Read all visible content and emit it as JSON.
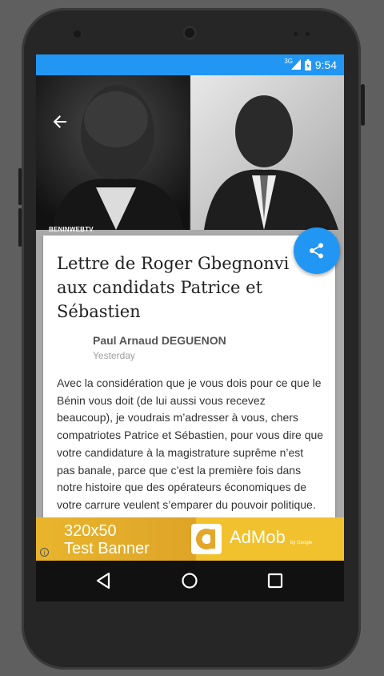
{
  "status_bar": {
    "network": "3G",
    "time": "9:54",
    "color": "#2196f3"
  },
  "hero": {
    "watermark": "BENINWEBTV"
  },
  "article": {
    "title": "Lettre de Roger Gbegnonvi aux candidats Patrice et Sébastien",
    "author": "Paul Arnaud DEGUENON",
    "date": "Yesterday",
    "body": "Avec la considération que je vous dois pour ce que le Bénin vous doit (de lui aussi vous recevez beaucoup), je voudrais m’adresser à vous, chers compatriotes Patrice et Sébastien, pour vous dire que votre candidature à la magistrature suprême n’est pas banale, parce que c’est la première fois dans notre histoire que des opérateurs économiques de votre carrure veulent s’emparer du pouvoir politique."
  },
  "ad": {
    "size": "320x50",
    "label": "Test Banner",
    "brand": "AdMob",
    "brand_sub": "by Google",
    "info": "i",
    "color": "#f2c12e"
  },
  "icons": {
    "back": "arrow-back-icon",
    "share": "share-icon",
    "nav_back": "triangle-back-icon",
    "nav_home": "circle-home-icon",
    "nav_recents": "square-recents-icon"
  }
}
